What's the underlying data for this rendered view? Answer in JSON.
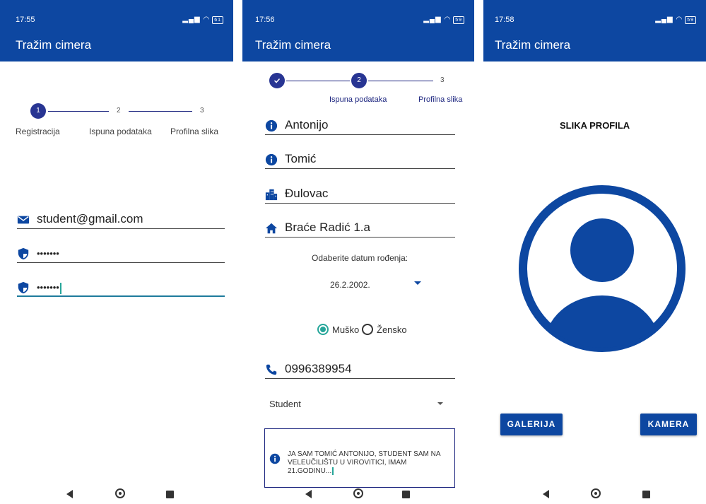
{
  "colors": {
    "primary": "#0d47a1",
    "stepper": "#283593",
    "accent": "#26a69a"
  },
  "screens": [
    {
      "status": {
        "time": "17:55",
        "battery": "61"
      },
      "title": "Tražim cimera",
      "stepper": {
        "steps": [
          {
            "number": "1",
            "label": "Registracija",
            "state": "active"
          },
          {
            "number": "2",
            "label": "Ispuna podataka",
            "state": "pending"
          },
          {
            "number": "3",
            "label": "Profilna slika",
            "state": "pending"
          }
        ]
      },
      "fields": {
        "email": {
          "icon": "envelope-icon",
          "value": "student@gmail.com"
        },
        "password": {
          "icon": "shield-icon",
          "value": "•••••••"
        },
        "confirm_password": {
          "icon": "shield-icon",
          "value": "•••••••"
        }
      }
    },
    {
      "status": {
        "time": "17:56",
        "battery": "59"
      },
      "title": "Tražim cimera",
      "stepper": {
        "steps": [
          {
            "number": "1",
            "label": "",
            "state": "done"
          },
          {
            "number": "2",
            "label": "Ispuna podataka",
            "state": "active"
          },
          {
            "number": "3",
            "label": "Profilna slika",
            "state": "pending"
          }
        ]
      },
      "fields": {
        "first_name": {
          "icon": "info-icon",
          "value": "Antonijo"
        },
        "last_name": {
          "icon": "info-icon",
          "value": "Tomić"
        },
        "city": {
          "icon": "city-icon",
          "value": "Đulovac"
        },
        "address": {
          "icon": "home-icon",
          "value": "Braće Radić 1.a"
        },
        "phone": {
          "icon": "phone-icon",
          "value": "0996389954"
        }
      },
      "birthdate": {
        "prompt": "Odaberite datum rođenja:",
        "value": "26.2.2002."
      },
      "gender": {
        "options": [
          "Muško",
          "Žensko"
        ],
        "selected": "Muško"
      },
      "occupation": {
        "value": "Student"
      },
      "bio": {
        "icon": "info-icon",
        "text": "JA SAM TOMIĆ ANTONIJO, STUDENT SAM NA VELEUČILIŠTU U VIROVITICI, IMAM 21.GODINU..."
      }
    },
    {
      "status": {
        "time": "17:58",
        "battery": "59"
      },
      "title": "Tražim cimera",
      "heading": "SLIKA PROFILA",
      "avatar_icon": "account-circle-icon",
      "buttons": {
        "gallery": "GALERIJA",
        "camera": "KAMERA"
      }
    }
  ]
}
